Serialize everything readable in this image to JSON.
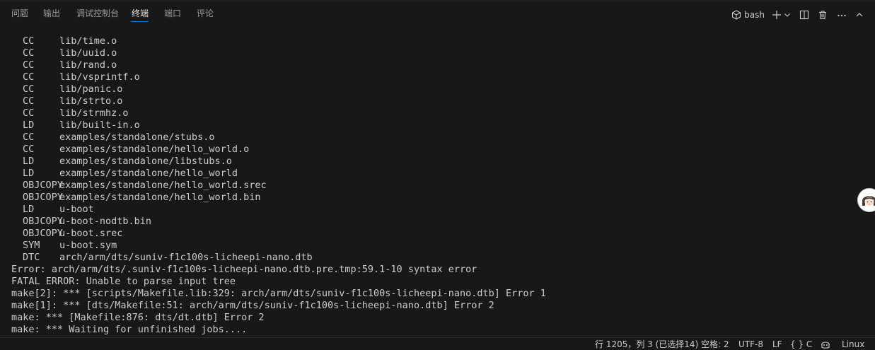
{
  "panel": {
    "tabs": [
      {
        "label": "问题"
      },
      {
        "label": "输出"
      },
      {
        "label": "调试控制台"
      },
      {
        "label": "终端"
      },
      {
        "label": "端口"
      },
      {
        "label": "评论"
      }
    ],
    "active_tab": "终端",
    "shell_label": "bash",
    "icons": [
      "terminal-shell-icon",
      "plus-icon",
      "chevron-down-icon",
      "split-icon",
      "trash-icon",
      "more-icon",
      "chevron-up-icon"
    ]
  },
  "terminal": {
    "build_lines": [
      {
        "cmd": "CC",
        "target": "lib/time.o"
      },
      {
        "cmd": "CC",
        "target": "lib/uuid.o"
      },
      {
        "cmd": "CC",
        "target": "lib/rand.o"
      },
      {
        "cmd": "CC",
        "target": "lib/vsprintf.o"
      },
      {
        "cmd": "CC",
        "target": "lib/panic.o"
      },
      {
        "cmd": "CC",
        "target": "lib/strto.o"
      },
      {
        "cmd": "CC",
        "target": "lib/strmhz.o"
      },
      {
        "cmd": "LD",
        "target": "lib/built-in.o"
      },
      {
        "cmd": "CC",
        "target": "examples/standalone/stubs.o"
      },
      {
        "cmd": "CC",
        "target": "examples/standalone/hello_world.o"
      },
      {
        "cmd": "LD",
        "target": "examples/standalone/libstubs.o"
      },
      {
        "cmd": "LD",
        "target": "examples/standalone/hello_world"
      },
      {
        "cmd": "OBJCOPY",
        "target": "examples/standalone/hello_world.srec"
      },
      {
        "cmd": "OBJCOPY",
        "target": "examples/standalone/hello_world.bin"
      },
      {
        "cmd": "LD",
        "target": "u-boot"
      },
      {
        "cmd": "OBJCOPY",
        "target": "u-boot-nodtb.bin"
      },
      {
        "cmd": "OBJCOPY",
        "target": "u-boot.srec"
      },
      {
        "cmd": "SYM",
        "target": "u-boot.sym"
      },
      {
        "cmd": "DTC",
        "target": "arch/arm/dts/suniv-f1c100s-licheepi-nano.dtb"
      }
    ],
    "error_lines": [
      "Error: arch/arm/dts/.suniv-f1c100s-licheepi-nano.dtb.pre.tmp:59.1-10 syntax error",
      "FATAL ERROR: Unable to parse input tree",
      "make[2]: *** [scripts/Makefile.lib:329: arch/arm/dts/suniv-f1c100s-licheepi-nano.dtb] Error 1",
      "make[1]: *** [dts/Makefile:51: arch/arm/dts/suniv-f1c100s-licheepi-nano.dtb] Error 2",
      "make: *** [Makefile:876: dts/dt.dtb] Error 2",
      "make: *** Waiting for unfinished jobs...."
    ]
  },
  "statusbar": {
    "cursor": "行 1205，列 3 (已选择14)",
    "indent": "空格: 2",
    "encoding": "UTF-8",
    "eol": "LF",
    "language": "{ } C",
    "platform": "Linux"
  },
  "colors": {
    "background": "#181818",
    "text": "#cccccc",
    "active_tab_underline": "#0078d4"
  }
}
